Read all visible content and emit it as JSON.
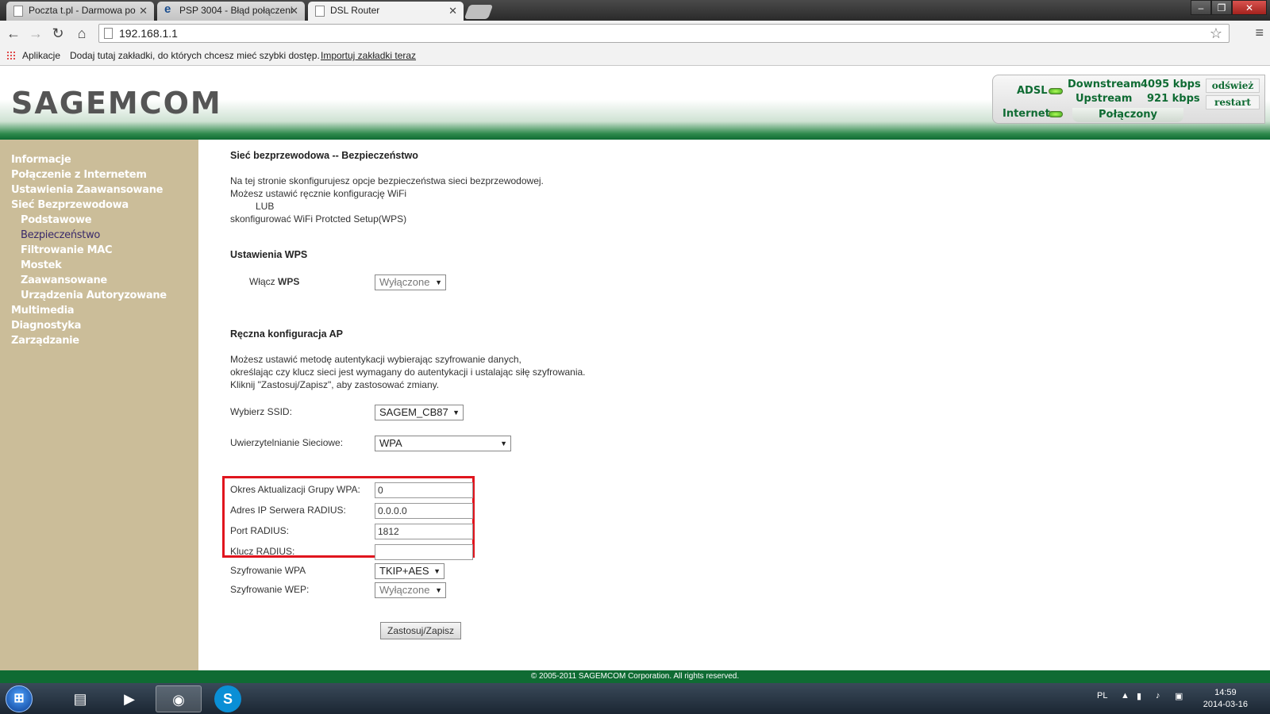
{
  "browser": {
    "tabs": [
      {
        "title": "Poczta t.pl - Darmowa po",
        "icon": "page-icon"
      },
      {
        "title": "PSP 3004 - Błąd połączeni",
        "icon": "ie-icon"
      },
      {
        "title": "DSL Router",
        "icon": "page-icon",
        "active": true
      }
    ],
    "url": "192.168.1.1",
    "bookmarks": {
      "apps_label": "Aplikacje",
      "hint": "Dodaj tutaj zakładki, do których chcesz mieć szybki dostęp.",
      "import_link": "Importuj zakładki teraz"
    }
  },
  "header": {
    "logo": "SAGEMCOM",
    "adsl_label": "ADSL",
    "internet_label": "Internet",
    "downstream_label": "Downstream",
    "downstream_value": "4095 kbps",
    "upstream_label": "Upstream",
    "upstream_value": "921 kbps",
    "refresh_label": "odśwież",
    "restart_label": "restart",
    "connection_status": "Połączony",
    "led_color": "#55cc22"
  },
  "sidebar": {
    "items": [
      {
        "label": "Informacje"
      },
      {
        "label": "Połączenie z Internetem"
      },
      {
        "label": "Ustawienia Zaawansowane"
      },
      {
        "label": "Sieć Bezprzewodowa"
      },
      {
        "label": "Podstawowe"
      },
      {
        "label": "Bezpieczeństwo"
      },
      {
        "label": "Filtrowanie MAC"
      },
      {
        "label": "Mostek"
      },
      {
        "label": "Zaawansowane"
      },
      {
        "label": "Urządzenia Autoryzowane"
      },
      {
        "label": "Multimedia"
      },
      {
        "label": "Diagnostyka"
      },
      {
        "label": "Zarządzanie"
      }
    ]
  },
  "main": {
    "title": "Sieć bezprzewodowa -- Bezpieczeństwo",
    "intro": [
      "Na tej stronie skonfigurujesz opcje bezpieczeństwa sieci bezprzewodowej.",
      "Możesz ustawić ręcznie konfigurację WiFi",
      "LUB",
      "skonfigurować WiFi Protcted Setup(WPS)"
    ],
    "wps": {
      "section_title": "Ustawienia WPS",
      "label_prefix": "Włącz",
      "label_bold": "WPS",
      "value": "Wyłączone"
    },
    "manual": {
      "section_title": "Ręczna konfiguracja AP",
      "desc": [
        "Możesz ustawić metodę autentykacji wybierając szyfrowanie danych,",
        "określając czy klucz sieci jest wymagany do autentykacji i ustalając siłę szyfrowania.",
        "Kliknij \"Zastosuj/Zapisz\", aby zastosować zmiany."
      ],
      "ssid_label": "Wybierz SSID:",
      "ssid_value": "SAGEM_CB87",
      "auth_label": "Uwierzytelnianie Sieciowe:",
      "auth_value": "WPA",
      "wpa_group_label": "Okres Aktualizacji Grupy WPA:",
      "wpa_group_value": "0",
      "radius_ip_label": "Adres IP Serwera RADIUS:",
      "radius_ip_value": "0.0.0.0",
      "radius_port_label": "Port RADIUS:",
      "radius_port_value": "1812",
      "radius_key_label": "Klucz RADIUS:",
      "radius_key_value": "",
      "wpa_enc_label": "Szyfrowanie WPA",
      "wpa_enc_value": "TKIP+AES",
      "wep_enc_label": "Szyfrowanie WEP:",
      "wep_enc_value": "Wyłączone",
      "apply_label": "Zastosuj/Zapisz",
      "highlight_color": "#e0151e"
    }
  },
  "footer": {
    "text": "© 2005-2011 SAGEMCOM Corporation. All rights reserved."
  },
  "taskbar": {
    "language": "PL",
    "time": "14:59",
    "date": "2014-03-16"
  }
}
